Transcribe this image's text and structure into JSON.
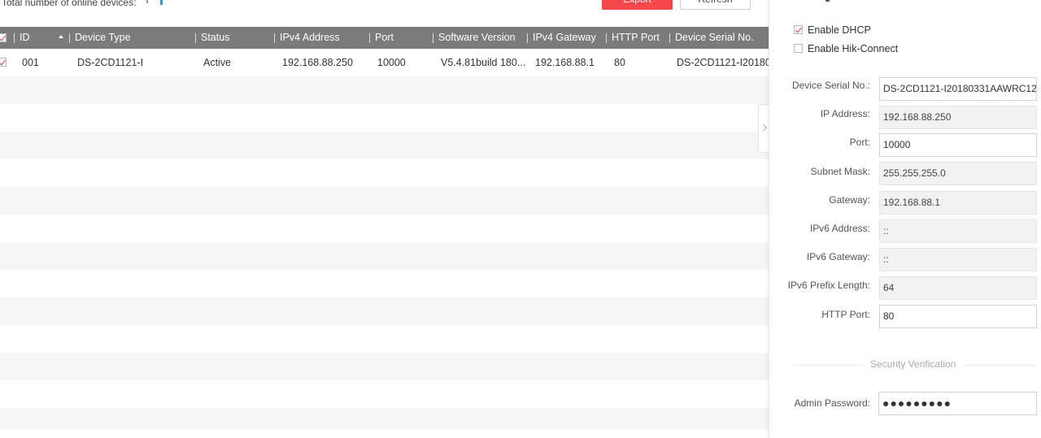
{
  "topbar": {
    "online_label": "Total number of online devices:",
    "export_label": "Export",
    "refresh_label": "Refresh"
  },
  "table": {
    "columns": [
      "ID",
      "Device Type",
      "Status",
      "IPv4 Address",
      "Port",
      "Software Version",
      "IPv4 Gateway",
      "HTTP Port",
      "Device Serial No."
    ],
    "rows": [
      {
        "checked": true,
        "id": "001",
        "device_type": "DS-2CD1121-I",
        "status": "Active",
        "ipv4": "192.168.88.250",
        "port": "10000",
        "software": "V5.4.81build 180...",
        "gateway": "192.168.88.1",
        "http_port": "80",
        "serial": "DS-2CD1121-I20180"
      }
    ]
  },
  "panel": {
    "enable_dhcp": {
      "label": "Enable DHCP",
      "checked": true
    },
    "enable_hik": {
      "label": "Enable Hik-Connect",
      "checked": false
    },
    "fields": {
      "serial": {
        "label": "Device Serial No.:",
        "value": "DS-2CD1121-I20180331AAWRC12"
      },
      "ip": {
        "label": "IP Address:",
        "value": "192.168.88.250"
      },
      "port": {
        "label": "Port:",
        "value": "10000"
      },
      "mask": {
        "label": "Subnet Mask:",
        "value": "255.255.255.0"
      },
      "gateway": {
        "label": "Gateway:",
        "value": "192.168.88.1"
      },
      "ipv6": {
        "label": "IPv6 Address:",
        "value": "::"
      },
      "ipv6gw": {
        "label": "IPv6 Gateway:",
        "value": "::"
      },
      "ipv6prefix": {
        "label": "IPv6 Prefix Length:",
        "value": "64"
      },
      "http": {
        "label": "HTTP Port:",
        "value": "80"
      }
    },
    "security_title": "Security Verification",
    "admin_password": {
      "label": "Admin Password:",
      "value": "●●●●●●●●●"
    }
  },
  "colors": {
    "accent_red": "#f5474c",
    "header_gray": "#7b7b7b",
    "progress_blue": "#2196f3"
  }
}
